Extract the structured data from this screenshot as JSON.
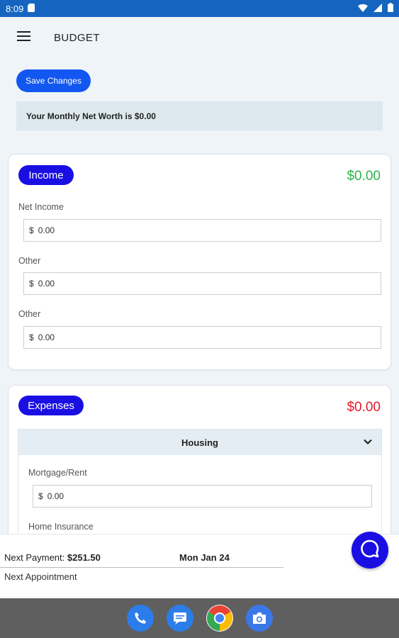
{
  "status_bar": {
    "time": "8:09"
  },
  "app": {
    "title": "BUDGET"
  },
  "actions": {
    "save_label": "Save Changes"
  },
  "networth": {
    "text": "Your Monthly Net Worth is $0.00"
  },
  "income": {
    "label": "Income",
    "total": "$0.00",
    "fields": [
      {
        "label": "Net Income",
        "currency": "$",
        "value": "0.00"
      },
      {
        "label": "Other",
        "currency": "$",
        "value": "0.00"
      },
      {
        "label": "Other",
        "currency": "$",
        "value": "0.00"
      }
    ]
  },
  "expenses": {
    "label": "Expenses",
    "total": "$0.00",
    "section": {
      "title": "Housing",
      "fields": [
        {
          "label": "Mortgage/Rent",
          "currency": "$",
          "value": "0.00"
        },
        {
          "label": "Home Insurance"
        }
      ]
    }
  },
  "footer": {
    "next_payment_label": "Next Payment:",
    "next_payment_amount": "$251.50",
    "next_payment_date": "Mon Jan 24",
    "next_appointment_label": "Next Appointment"
  },
  "colors": {
    "accent": "#1257f1",
    "pill": "#1a0fe3",
    "income_total": "#2bb24c",
    "expenses_total": "#e8182a",
    "status_bar": "#1565c0"
  },
  "dock": [
    "phone-icon",
    "messages-icon",
    "chrome-icon",
    "camera-icon"
  ]
}
